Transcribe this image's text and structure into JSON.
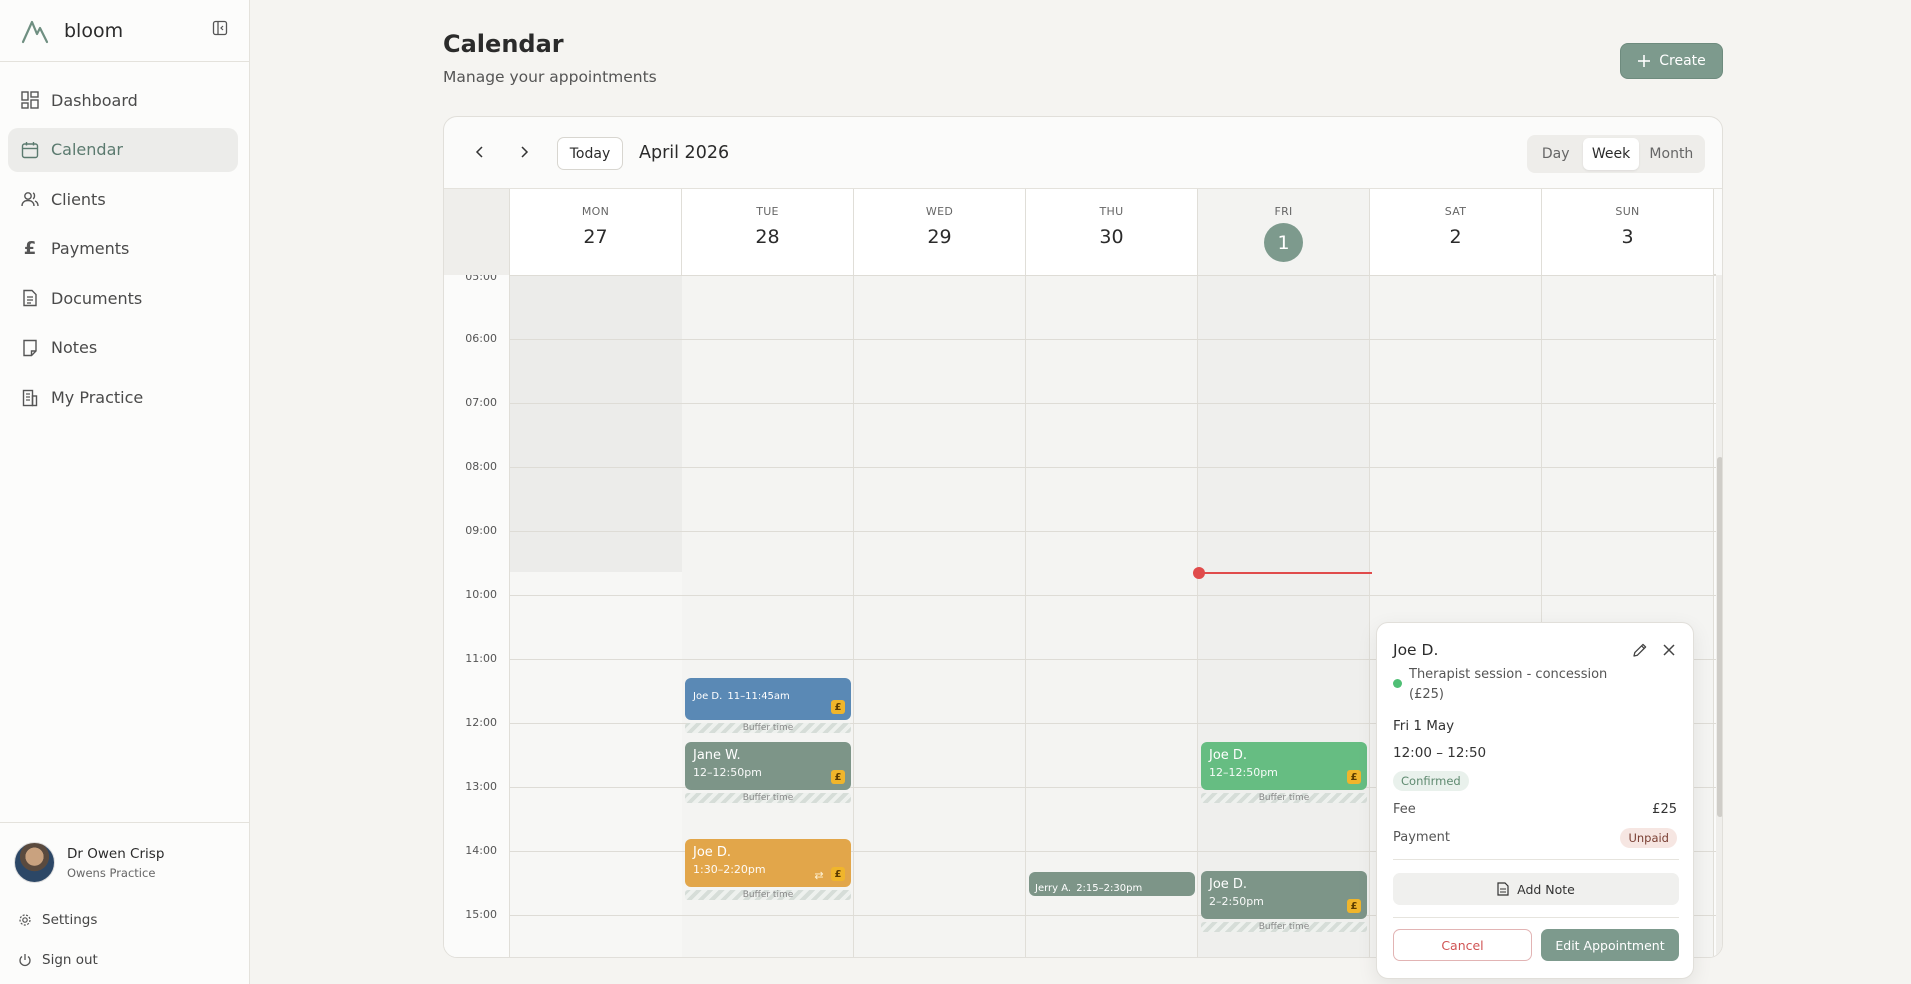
{
  "app": {
    "name": "bloom"
  },
  "sidebar": {
    "items": [
      {
        "label": "Dashboard",
        "icon": "dashboard-icon"
      },
      {
        "label": "Calendar",
        "icon": "calendar-icon",
        "active": true
      },
      {
        "label": "Clients",
        "icon": "users-icon"
      },
      {
        "label": "Payments",
        "icon": "pound-icon"
      },
      {
        "label": "Documents",
        "icon": "document-icon"
      },
      {
        "label": "Notes",
        "icon": "note-icon"
      },
      {
        "label": "My Practice",
        "icon": "building-icon"
      }
    ],
    "profile": {
      "name": "Dr Owen Crisp",
      "practice": "Owens Practice"
    },
    "settings_label": "Settings",
    "signout_label": "Sign out"
  },
  "header": {
    "title": "Calendar",
    "subtitle": "Manage your appointments",
    "create_label": "Create"
  },
  "toolbar": {
    "today_label": "Today",
    "month_label": "April 2026",
    "views": [
      "Day",
      "Week",
      "Month"
    ],
    "active_view": "Week"
  },
  "days": [
    {
      "name": "MON",
      "num": "27"
    },
    {
      "name": "TUE",
      "num": "28"
    },
    {
      "name": "WED",
      "num": "29"
    },
    {
      "name": "THU",
      "num": "30"
    },
    {
      "name": "FRI",
      "num": "1",
      "today": true
    },
    {
      "name": "SAT",
      "num": "2"
    },
    {
      "name": "SUN",
      "num": "3"
    }
  ],
  "times": [
    "05:00",
    "06:00",
    "07:00",
    "08:00",
    "09:00",
    "10:00",
    "11:00",
    "12:00",
    "13:00",
    "14:00",
    "15:00"
  ],
  "events": {
    "tue_1": {
      "title": "Joe D.",
      "time": "11–11:45am",
      "buffer": "Buffer time"
    },
    "tue_2": {
      "title": "Jane W.",
      "time": "12–12:50pm",
      "buffer": "Buffer time"
    },
    "tue_3": {
      "title": "Joe D.",
      "time": "1:30–2:20pm",
      "buffer": "Buffer time"
    },
    "thu_1": {
      "title": "Jerry A.",
      "time": "2:15–2:30pm"
    },
    "fri_1": {
      "title": "Joe D.",
      "time": "12–12:50pm",
      "buffer": "Buffer time"
    },
    "fri_2": {
      "title": "Joe D.",
      "time": "2–2:50pm",
      "buffer": "Buffer time"
    },
    "pound_symbol": "£"
  },
  "popover": {
    "client": "Joe D.",
    "type": "Therapist session - concession (£25)",
    "date": "Fri 1 May",
    "time": "12:00 – 12:50",
    "status": "Confirmed",
    "fee_label": "Fee",
    "fee_value": "£25",
    "payment_label": "Payment",
    "payment_value": "Unpaid",
    "add_note_label": "Add Note",
    "cancel_label": "Cancel",
    "edit_label": "Edit Appointment"
  },
  "colors": {
    "accent": "#7d9a8d",
    "now_line": "#e04b4b",
    "event_blue": "#5a89b5",
    "event_grey": "#7d9588",
    "event_orange": "#e2a64a",
    "event_green": "#66bd82"
  }
}
